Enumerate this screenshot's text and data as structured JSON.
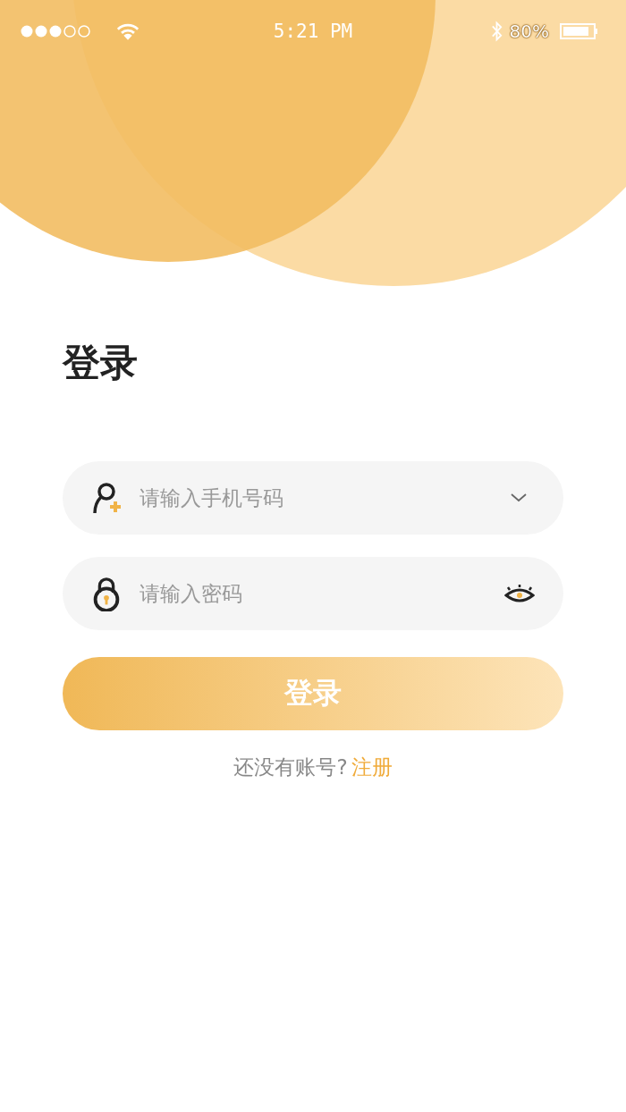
{
  "status_bar": {
    "time": "5:21 PM",
    "battery": "80%"
  },
  "title": "登录",
  "fields": [
    {
      "kind": "phone",
      "placeholder": "请输入手机号码"
    },
    {
      "kind": "password",
      "placeholder": "请输入密码"
    }
  ],
  "login_button": "登录",
  "register_prompt": {
    "text": "还没有账号?",
    "link": "注册"
  }
}
